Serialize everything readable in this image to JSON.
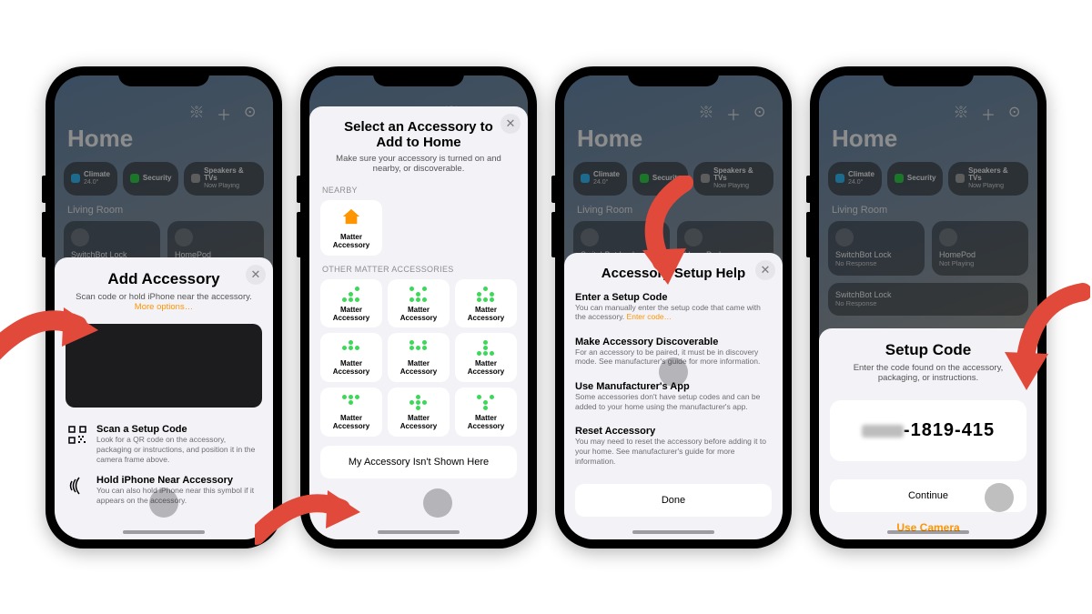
{
  "home_bg": {
    "title": "Home",
    "chips": [
      {
        "label": "Climate",
        "sub": "24.0°",
        "color": "#34c3ff"
      },
      {
        "label": "Security",
        "sub": "",
        "color": "#32d74b"
      },
      {
        "label": "Speakers & TVs",
        "sub": "Now Playing",
        "color": "#8e8e93"
      }
    ],
    "room_label": "Living Room",
    "tiles": [
      {
        "name": "SwitchBot Lock",
        "sub": "No Response",
        "kind": "lock"
      },
      {
        "name": "HomePod",
        "sub": "Not Playing",
        "kind": "speaker"
      }
    ],
    "long_tile": {
      "name": "SwitchBot Lock",
      "sub": "No Response"
    }
  },
  "p1": {
    "title": "Add Accessory",
    "sub_pre": "Scan code or hold iPhone near the accessory.",
    "more": "More options…",
    "scan_title": "Scan a Setup Code",
    "scan_desc": "Look for a QR code on the accessory, packaging or instructions, and position it in the camera frame above.",
    "nfc_title": "Hold iPhone Near Accessory",
    "nfc_desc": "You can also hold iPhone near this symbol if it appears on the accessory."
  },
  "p2": {
    "title": "Select an Accessory to Add to Home",
    "sub": "Make sure your accessory is turned on and nearby, or discoverable.",
    "section_nearby": "NEARBY",
    "section_other": "OTHER MATTER ACCESSORIES",
    "nearby_label": "Matter Accessory",
    "matter_label": "Matter Accessory",
    "footer_btn": "My Accessory Isn't Shown Here"
  },
  "p3": {
    "title": "Accessory Setup Help",
    "items": [
      {
        "t": "Enter a Setup Code",
        "d": "You can manually enter the setup code that came with the accessory.",
        "link": "Enter code…"
      },
      {
        "t": "Make Accessory Discoverable",
        "d": "For an accessory to be paired, it must be in discovery mode. See manufacturer's guide for more information."
      },
      {
        "t": "Use Manufacturer's App",
        "d": "Some accessories don't have setup codes and can be added to your home using the manufacturer's app."
      },
      {
        "t": "Reset Accessory",
        "d": "You may need to reset the accessory before adding it to your home. See manufacturer's guide for more information."
      }
    ],
    "done": "Done"
  },
  "p4": {
    "title": "Setup Code",
    "sub": "Enter the code found on the accessory, packaging, or instructions.",
    "code_suffix": "-1819-415",
    "continue": "Continue",
    "use_camera": "Use Camera"
  }
}
